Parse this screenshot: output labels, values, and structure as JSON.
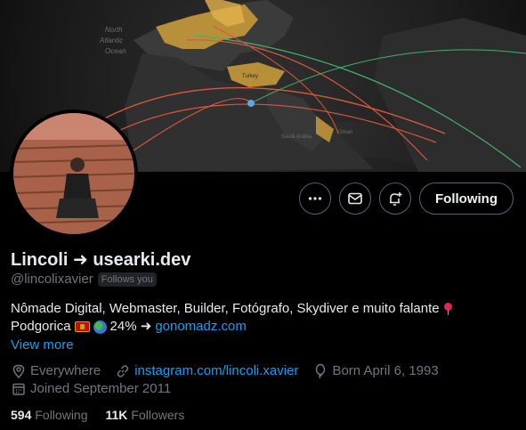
{
  "banner": {
    "map_labels": [
      "North",
      "Atlantic",
      "Ocean",
      "Turkey",
      "Saudi Arabia",
      "Oman"
    ]
  },
  "profile": {
    "name": "Lincoli ➜ usearki.dev",
    "handle": "@lincolixavier",
    "follows_you": "Follows you"
  },
  "actions": {
    "more_icon": "more-icon",
    "message_icon": "envelope-icon",
    "notify_icon": "bell-plus-icon",
    "following_label": "Following"
  },
  "bio": {
    "line1": "Nômade Digital, Webmaster, Builder, Fotógrafo, Skydiver e muito falante",
    "line2_place": "Podgorica",
    "line2_percent": "24% ➜",
    "line2_link": "gonomadz.com",
    "view_more": "View more"
  },
  "meta": {
    "location": "Everywhere",
    "website": "instagram.com/lincoli.xavier",
    "born": "Born April 6, 1993",
    "joined": "Joined September 2011"
  },
  "stats": {
    "following_count": "594",
    "following_label": "Following",
    "followers_count": "11K",
    "followers_label": "Followers"
  },
  "colors": {
    "accent": "#1d9bf0",
    "muted": "#71767b",
    "background": "#000000",
    "text": "#e7e9ea"
  }
}
